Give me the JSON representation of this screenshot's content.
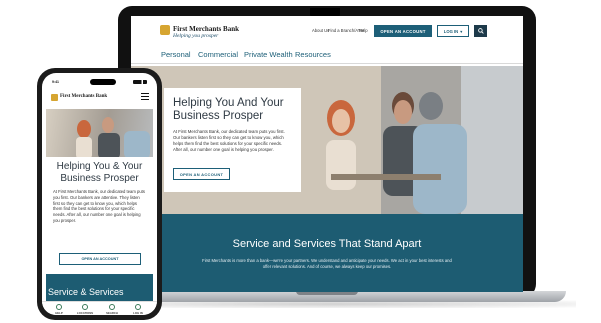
{
  "desktop": {
    "brand": {
      "name": "First Merchants Bank",
      "tagline": "Helping you prosper"
    },
    "utility_links": [
      "About Us",
      "Find a Branch/ATM",
      "Help"
    ],
    "open_account_label": "OPEN AN ACCOUNT",
    "login_label": "LOG IN",
    "nav": [
      "Personal",
      "Commercial",
      "Private Wealth",
      "Resources"
    ],
    "hero": {
      "title": "Helping You And Your Business Prosper",
      "body": "At First Merchants Bank, our dedicated team puts you first. Our bankers listen first so they can get to know you, which helps them find the best solutions for your specific needs. After all, our number one goal is helping you prosper.",
      "cta": "OPEN AN ACCOUNT"
    },
    "section": {
      "title": "Service and Services That Stand Apart",
      "body": "First Merchants is more than a bank—we're your partners. We understand and anticipate your needs. We act in your best interests and offer relevant solutions. And of course, we always keep our promises."
    }
  },
  "mobile": {
    "status_carrier": "9:41",
    "brand": "First Merchants Bank",
    "hero": {
      "title": "Helping You & Your Business Prosper",
      "body": "At First Merchants Bank, our dedicated team puts you first. Our bankers are attentive. They listen first so they can get to know you, which helps them find the best solutions for your specific needs. After all, our number one goal is helping you prosper.",
      "cta": "OPEN AN ACCOUNT"
    },
    "section_title": "Service & Services",
    "tabs": [
      "HELP",
      "LOCATIONS",
      "SEARCH",
      "LOG IN"
    ]
  },
  "colors": {
    "teal": "#1d5c72",
    "gold": "#d6a531",
    "primary_button": "#1d5f78"
  }
}
